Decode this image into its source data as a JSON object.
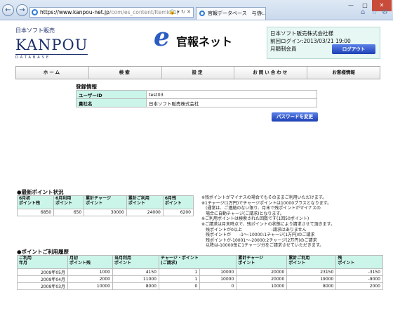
{
  "browser": {
    "address_domain": "https://www.kanpou-net.jp",
    "address_rest": "/com/es_content/Itemid,1(",
    "tab_title": "官報データベース　与信..."
  },
  "header": {
    "brand_small": "日本ソフト販売",
    "brand_large": "KANPOU",
    "brand_sub": "DATABASE",
    "site_logo_e": "e",
    "site_logo_text": "官報ネット",
    "user_name": "日本ソフト販売株式会社様",
    "last_login": "前回ログイン:2013/03/21 19:00",
    "plan": "月額制会員",
    "logout_label": "ログアウト"
  },
  "menu": [
    "ホーム",
    "検索",
    "設定",
    "お問い合わせ",
    "お客様情報"
  ],
  "registration": {
    "title": "登録情報",
    "rows": [
      {
        "label": "ユーザーID",
        "value": "test03"
      },
      {
        "label": "貴社名",
        "value": "日本ソフト販売株式会社"
      }
    ],
    "password_button": "パスワードを変更"
  },
  "points_status": {
    "title": "●最新ポイント状況",
    "headers": [
      "6月初\nポイント残",
      "6月利用\nポイント",
      "累計チャージ\nポイント",
      "累計ご利用\nポイント",
      "6月残\nポイント"
    ],
    "values": [
      "6850",
      "650",
      "30000",
      "24000",
      "6200"
    ]
  },
  "notes": "※残ポイントがマイナスの場合でもそのままご利用いただけます。\n※1チャージ(1万円)でチャージポイントは10000プラスとなります。\n　(通常は、ご連絡のない限り、月末で残ポイントがマイナスの\n　場合に自動チャージ(ご請求)となります。\n※ご利用ポイントは検索された回数です(1回50ポイント)\n※ご請求は月末時点で、残ポイントの状態により請求させて頂きます。\n　残ポイントが0以上　　　　　　　:請求はありません\n　残ポイントが　　-1〜-10000:1チャージ(1万円)のご請求\n　残ポイントが-10001〜-20000:2チャージ(2万円)のご請求\n　以降は-10000毎に1チャージ分をご請求させていただきます。",
  "history": {
    "title": "●ポイントご利用履歴",
    "headers": [
      "ご利用\n年月",
      "月初\nポイント残",
      "当月利用\nポイント",
      "チャージ・ポイント\n(ご請求)",
      "",
      "累計チャージ\nポイント",
      "累計ご利用\nポイント",
      "残\nポイント"
    ],
    "rows": [
      [
        "2009年05月",
        "1000",
        "4150",
        "1",
        "10000",
        "20000",
        "23150",
        "-3150"
      ],
      [
        "2009年04月",
        "2000",
        "11000",
        "1",
        "10000",
        "20000",
        "19000",
        "-9000"
      ],
      [
        "2009年03月",
        "10000",
        "8000",
        "0",
        "0",
        "10000",
        "8000",
        "2000"
      ]
    ]
  }
}
